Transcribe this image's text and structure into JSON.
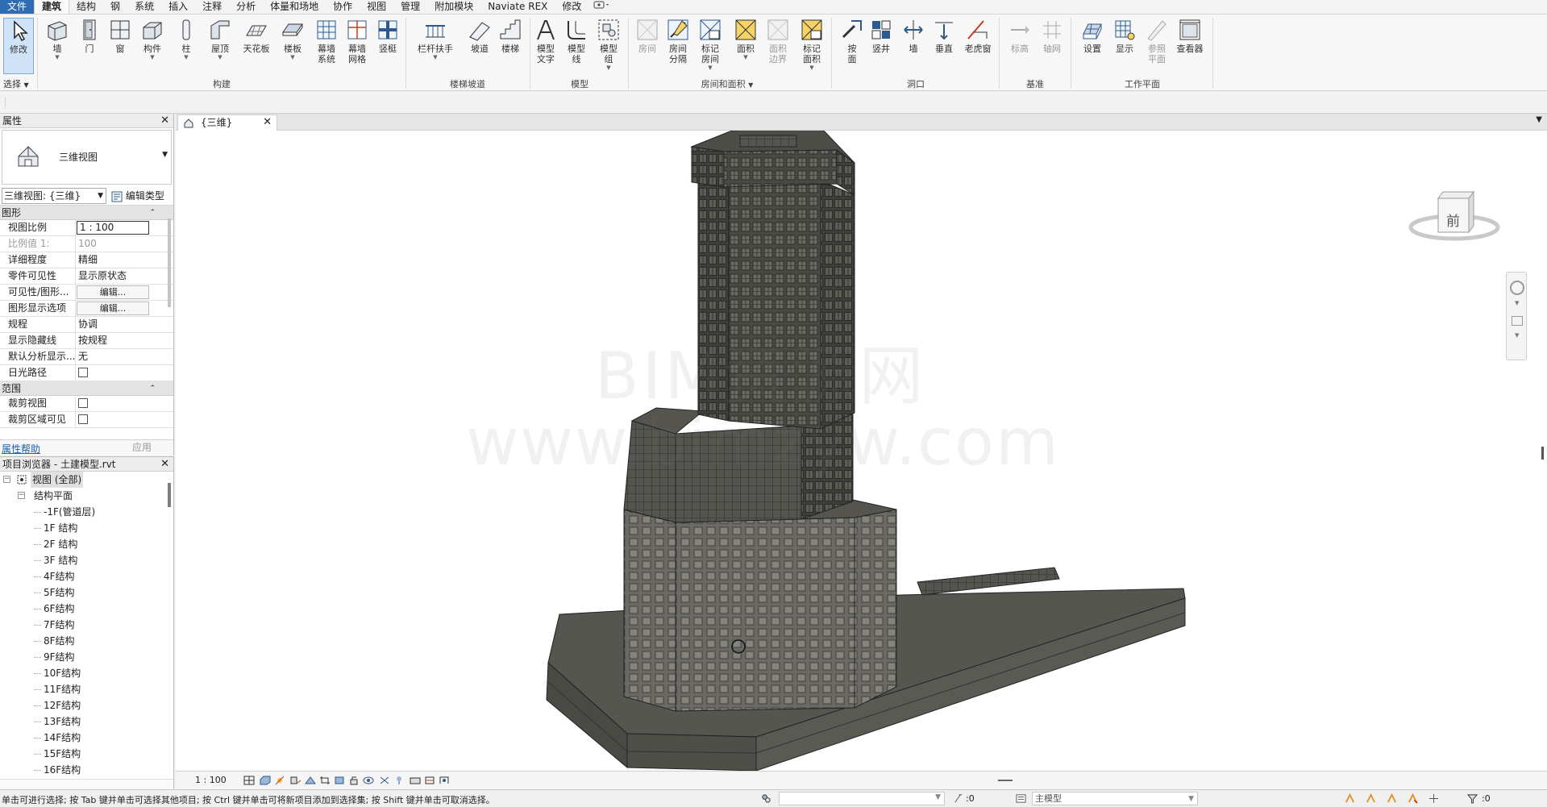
{
  "menu": {
    "tabs": [
      "文件",
      "建筑",
      "结构",
      "钢",
      "系统",
      "插入",
      "注释",
      "分析",
      "体量和场地",
      "协作",
      "视图",
      "管理",
      "附加模块",
      "Naviate REX",
      "修改"
    ],
    "active_index": 1
  },
  "ribbon": {
    "modify": "修改",
    "select": "选择",
    "build": {
      "title": "构建",
      "buttons": [
        "墙",
        "门",
        "窗",
        "构件",
        "柱",
        "屋顶",
        "天花板",
        "楼板",
        "幕墙\n系统",
        "幕墙\n网格",
        "竖梃"
      ]
    },
    "stairs": {
      "title": "楼梯坡道",
      "buttons": [
        "栏杆扶手",
        "坡道",
        "楼梯"
      ]
    },
    "model": {
      "title": "模型",
      "buttons": [
        "模型\n文字",
        "模型\n线",
        "模型\n组"
      ]
    },
    "room": {
      "title": "房间和面积",
      "buttons": [
        "房间",
        "房间\n分隔",
        "标记\n房间",
        "面积",
        "面积\n边界",
        "标记\n面积"
      ]
    },
    "opening": {
      "title": "洞口",
      "buttons": [
        "按\n面",
        "竖井",
        "墙",
        "垂直",
        "老虎窗"
      ]
    },
    "datum": {
      "title": "基准",
      "buttons": [
        "标高",
        "轴网"
      ]
    },
    "workplane": {
      "title": "工作平面",
      "buttons": [
        "设置",
        "显示",
        "参照\n平面",
        "查看器"
      ]
    },
    "colors": {
      "accent": "#2e6db4",
      "selected": "#cfe3f6"
    }
  },
  "properties": {
    "title": "属性",
    "type_name": "三维视图",
    "view_combo": "三维视图: {三维}",
    "edit_type": "编辑类型",
    "group_graphics": "图形",
    "rows": [
      {
        "k": "视图比例",
        "v": "1 : 100",
        "kind": "box"
      },
      {
        "k": "比例值 1:",
        "v": "100",
        "kind": "dis"
      },
      {
        "k": "详细程度",
        "v": "精细"
      },
      {
        "k": "零件可见性",
        "v": "显示原状态"
      },
      {
        "k": "可见性/图形...",
        "v": "编辑...",
        "kind": "btn"
      },
      {
        "k": "图形显示选项",
        "v": "编辑...",
        "kind": "btn"
      },
      {
        "k": "规程",
        "v": "协调"
      },
      {
        "k": "显示隐藏线",
        "v": "按规程"
      },
      {
        "k": "默认分析显示...",
        "v": "无"
      },
      {
        "k": "日光路径",
        "v": "",
        "kind": "cb"
      }
    ],
    "group_extents": "范围",
    "rows2": [
      {
        "k": "裁剪视图",
        "v": "",
        "kind": "cb"
      },
      {
        "k": "裁剪区域可见",
        "v": "",
        "kind": "cb"
      }
    ],
    "help": "属性帮助",
    "apply": "应用"
  },
  "browser": {
    "title": "项目浏览器 - 土建模型.rvt",
    "root": "视图 (全部)",
    "group": "结构平面",
    "items": [
      "-1F(管道层)",
      "1F 结构",
      "2F 结构",
      "3F 结构",
      "4F结构",
      "5F结构",
      "6F结构",
      "7F结构",
      "8F结构",
      "9F结构",
      "10F结构",
      "11F结构",
      "12F结构",
      "13F结构",
      "14F结构",
      "15F结构",
      "16F结构"
    ]
  },
  "view": {
    "tab": "{三维}",
    "watermark_line1": "BIM资源网",
    "watermark_line2": "www.bimzyw.com",
    "cube_face": "前",
    "scale": "1 : 100"
  },
  "status": {
    "message": "单击可进行选择; 按 Tab 键并单击可选择其他项目; 按 Ctrl 键并单击可将新项目添加到选择集; 按 Shift 键并单击可取消选择。",
    "filter_count": ":0",
    "model": "主模型",
    "select_count": ":0"
  }
}
